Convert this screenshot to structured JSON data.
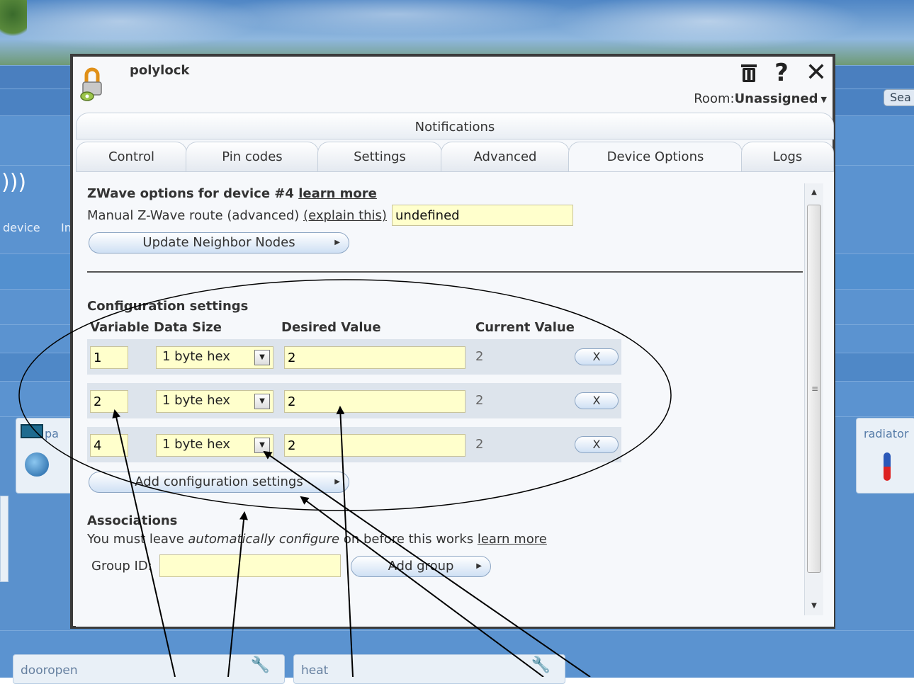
{
  "background": {
    "search_label": "Sea",
    "nav_items": [
      "device",
      "In"
    ],
    "left_card_label": "pa",
    "right_card_label": "radiator",
    "bottom_cards": [
      {
        "label": "dooropen"
      },
      {
        "label": "heat"
      }
    ]
  },
  "dialog": {
    "title": "polylock",
    "icons": [
      "lock-icon",
      "trash-icon",
      "help-icon",
      "close-icon"
    ],
    "room_label": "Room:",
    "room_value": "Unassigned",
    "notifications_tab": "Notifications",
    "tabs": [
      {
        "label": "Control",
        "active": false
      },
      {
        "label": "Pin codes",
        "active": false
      },
      {
        "label": "Settings",
        "active": false
      },
      {
        "label": "Advanced",
        "active": false
      },
      {
        "label": "Device Options",
        "active": true
      },
      {
        "label": "Logs",
        "active": false
      }
    ],
    "zwave": {
      "title": "ZWave options for device #4",
      "learn_more": "learn more",
      "route_label": "Manual Z-Wave route (advanced)",
      "explain_link": "(explain this)",
      "route_value": "undefined",
      "update_button": "Update Neighbor Nodes"
    },
    "config": {
      "title": "Configuration settings",
      "columns": [
        "Variable",
        "Data Size",
        "Desired Value",
        "Current Value"
      ],
      "rows": [
        {
          "variable": "1",
          "data_size": "1 byte hex",
          "desired": "2",
          "current": "2",
          "remove": "X"
        },
        {
          "variable": "2",
          "data_size": "1 byte hex",
          "desired": "2",
          "current": "2",
          "remove": "X"
        },
        {
          "variable": "4",
          "data_size": "1 byte hex",
          "desired": "2",
          "current": "2",
          "remove": "X"
        }
      ],
      "add_button": "Add configuration settings"
    },
    "associations": {
      "title": "Associations",
      "note_prefix": "You must leave ",
      "note_italic": "automatically configure",
      "note_suffix": " on before this works ",
      "learn_more": "learn more",
      "group_label": "Group ID:",
      "group_value": "",
      "add_group_button": "Add group"
    }
  },
  "colors": {
    "input_bg": "#ffffcc",
    "dialog_border": "#3b3b3b",
    "background_blue": "#5b93d0"
  }
}
